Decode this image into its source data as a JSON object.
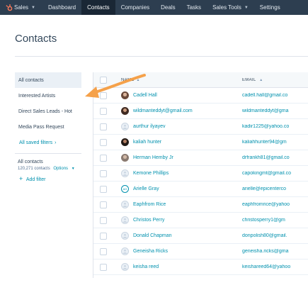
{
  "nav": {
    "brand": "Sales",
    "items": [
      {
        "label": "Dashboard"
      },
      {
        "label": "Contacts"
      },
      {
        "label": "Companies"
      },
      {
        "label": "Deals"
      },
      {
        "label": "Tasks"
      },
      {
        "label": "Sales Tools"
      },
      {
        "label": "Settings"
      }
    ],
    "active": "Contacts",
    "bg_color": "#2d3e50",
    "logo_color": "#ff7a59"
  },
  "page": {
    "title": "Contacts"
  },
  "sidebar": {
    "views": [
      {
        "label": "All contacts"
      },
      {
        "label": "Interested Artists"
      },
      {
        "label": "Direct Sales Leads - Hot"
      },
      {
        "label": "Media Pass Request"
      }
    ],
    "saved_filters": "All saved filters",
    "section_title": "All contacts",
    "count": "120,271 contacts",
    "options": "Options",
    "add_filter": "Add filter"
  },
  "table": {
    "headers": {
      "name": "NAME",
      "email": "EMAIL"
    },
    "rows": [
      {
        "name": "Cadell Hall",
        "email": "cadell.hall@gmail.co",
        "avatar": "photo"
      },
      {
        "name": "wildmanteddyt@gmail.com",
        "email": "wildmanteddyt@gma",
        "avatar": "photo"
      },
      {
        "name": "aurthur ilyayev",
        "email": "kadir1225@yahoo.co",
        "avatar": "generic"
      },
      {
        "name": "kaliah hunter",
        "email": "kaliahhunter94@gm",
        "avatar": "photo"
      },
      {
        "name": "Herman Hemby Jr",
        "email": "drfrankh81@gmail.co",
        "avatar": "photo"
      },
      {
        "name": "Kemone Phillips",
        "email": "capokingmt@gmail.co",
        "avatar": "generic"
      },
      {
        "name": "Arielle Gray",
        "email": "arielle@epicenterco",
        "avatar": "initials",
        "initials": "AG"
      },
      {
        "name": "Eaphfrom Rice",
        "email": "eaphfromrice@yahoo",
        "avatar": "generic"
      },
      {
        "name": "Christos Perry",
        "email": "christosperry1@gm",
        "avatar": "generic"
      },
      {
        "name": "Donald Chapman",
        "email": "donpolish80@gmail.",
        "avatar": "generic"
      },
      {
        "name": "Geneisha Ricks",
        "email": "geneisha.ricks@gma",
        "avatar": "generic"
      },
      {
        "name": "keisha reed",
        "email": "keishareed64@yahoo",
        "avatar": "generic"
      }
    ]
  },
  "colors": {
    "link": "#0091ae",
    "text": "#33475b",
    "accent_arrow": "#f5a14a"
  }
}
